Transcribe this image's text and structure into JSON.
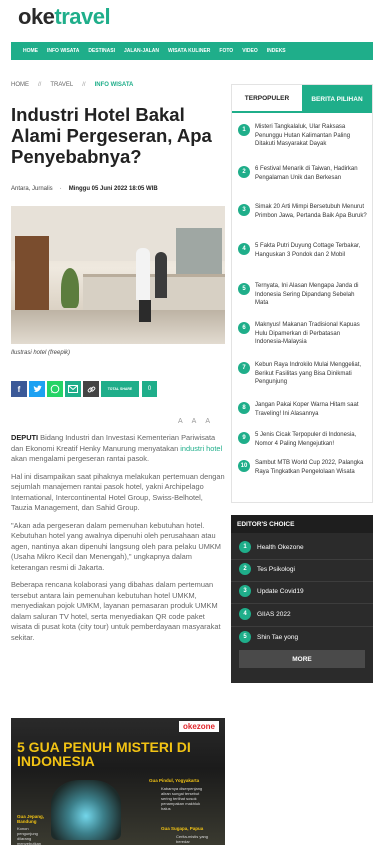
{
  "brand": {
    "part1": "oke",
    "part2": "travel"
  },
  "nav": [
    "HOME",
    "INFO WISATA",
    "DESTINASI",
    "JALAN-JALAN",
    "WISATA KULINER",
    "FOTO",
    "VIDEO",
    "INDEKS"
  ],
  "breadcrumb": [
    "HOME",
    "TRAVEL",
    "INFO WISATA"
  ],
  "breadcrumb_sep": "//",
  "article": {
    "title": "Industri Hotel Bakal Alami Pergeseran, Apa Penyebabnya?",
    "author": "Antara, Jurnalis",
    "dot": "·",
    "date": "Minggu 05 Juni 2022 18:05 WIB",
    "caption": "Ilustrasi hotel (freepik)",
    "font_sizes": [
      "A",
      "A",
      "A"
    ],
    "p1_lead": "DEPUTI",
    "p1_a": " Bidang Industri dan Investasi Kementerian Pariwisata dan Ekonomi Kreatif Henky Manurung menyatakan ",
    "p1_link": "industri hotel",
    "p1_b": " akan mengalami pergeseran rantai pasok.",
    "p2": "Hal ini disampaikan saat pihaknya melakukan pertemuan dengan sejumlah manajemen rantai pasok hotel, yakni Archipelago International, Intercontinental Hotel Group, Swiss-Belhotel, Tauzia Management, dan Sahid Group.",
    "p3": "\"Akan ada pergeseran dalam pemenuhan kebutuhan hotel. Kebutuhan hotel yang awalnya dipenuhi oleh perusahaan atau agen, nantinya akan dipenuhi langsung oleh para pelaku UMKM (Usaha Mikro Kecil dan Menengah),\" ungkapnya dalam keterangan resmi di Jakarta.",
    "p4": "Beberapa rencana kolaborasi yang dibahas dalam pertemuan tersebut antara lain pemenuhan kebutuhan hotel UMKM, menyediakan pojok UMKM, layanan pemasaran produk UMKM dalam saluran TV hotel, serta menyediakan QR code paket wisata di pusat kota (city tour) untuk pemberdayaan masyarakat sekitar."
  },
  "share": {
    "total_label": "TOTAL SHARE",
    "count": "0"
  },
  "ad": {
    "brand": "okezone",
    "headline": "5 GUA PENUH MISTERI DI INDONESIA",
    "label1": "Gua Pindul, Yogyakarta",
    "text1": "Kabarnya diserpenjang aliran sungai tersebut sering terlihat sosok penampakan makhluk halus",
    "label2": "Gua Jepang, Bandung",
    "text2": "Konon pengunjung dilarang menyebutkan",
    "label3": "Gua Sugapa, Papua",
    "text3": "Cerita-mistis yang beredar"
  },
  "sidebar": {
    "tab_popular": "TERPOPULER",
    "tab_choice": "BERITA PILIHAN",
    "items": [
      "Misteri Tangkalaluk, Ular Raksasa Penunggu Hutan Kalimantan Paling Ditakuti Masyarakat Dayak",
      "6 Festival Menarik di Taiwan, Hadirkan Pengalaman Unik dan Berkesan",
      "Simak 20 Arti Mimpi Bersetubuh Menurut Primbon Jawa, Pertanda Baik Apa Buruk?",
      "5 Fakta Putri Duyung Cottage Terbakar, Hanguskan 3 Pondok dan 2 Mobil",
      "Ternyata, Ini Alasan Mengapa Janda di Indonesia Sering Dipandang Sebelah Mata",
      "Maknyus! Makanan Tradisional Kapuas Hulu Dipamerkan di Perbatasan Indonesia-Malaysia",
      "Kebun Raya Indrokilo Mulai Menggeliat, Berikut Fasilitas yang Bisa Dinikmati Pengunjung",
      "Jangan Pakai Koper Warna Hitam saat Traveling! Ini Alasannya",
      "5 Jenis Cicak Terpopuler di Indonesia, Nomor 4 Paling Mengejutkan!",
      "Sambut MTB World Cup 2022, Palangka Raya Tingkatkan Pengelolaan Wisata"
    ]
  },
  "editors_choice": {
    "title": "EDITOR'S CHOICE",
    "items": [
      "Health Okezone",
      "Tes Psikologi",
      "Update Covid19",
      "GIIAS 2022",
      "Shin Tae yong"
    ],
    "more": "MORE"
  },
  "colors": {
    "accent": "#1fae8a",
    "facebook": "#3b5998",
    "twitter": "#1da1f2",
    "whatsapp": "#25d366",
    "email": "#1fae8a",
    "link": "#444444"
  }
}
